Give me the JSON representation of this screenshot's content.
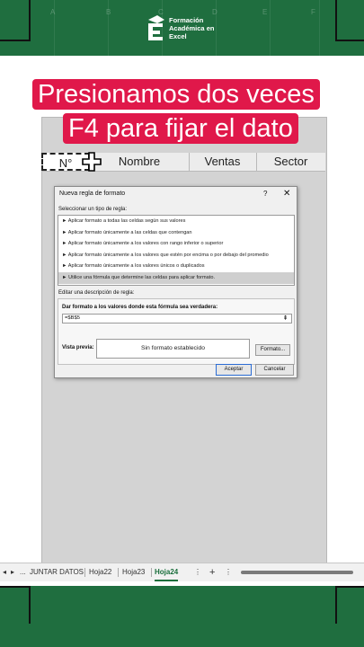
{
  "brand": {
    "logo_text": "Formación\nAcadémica en\nExcel",
    "green": "#1f6e3f",
    "pink": "#e0184a"
  },
  "background_column_letters": [
    "A",
    "B",
    "C",
    "D",
    "E",
    "F"
  ],
  "headline": {
    "line1": "Presionamos dos veces",
    "line2": "F4 para fijar el dato"
  },
  "sheet": {
    "headers": [
      "N°",
      "Nombre",
      "Ventas",
      "Sector"
    ],
    "selected_header": "N°"
  },
  "dialog": {
    "title": "Nueva regla de formato",
    "help": "?",
    "close": "✕",
    "select_label": "Seleccionar un tipo de regla:",
    "rule_types": [
      "► Aplicar formato a todas las celdas según sus valores",
      "► Aplicar formato únicamente a las celdas que contengan",
      "► Aplicar formato únicamente a los valores con rango inferior o superior",
      "► Aplicar formato únicamente a los valores que estén por encima o por debajo del promedio",
      "► Aplicar formato únicamente a los valores únicos o duplicados",
      "► Utilice una fórmula que determine las celdas para aplicar formato."
    ],
    "selected_rule_index": 5,
    "edit_label": "Editar una descripción de regla:",
    "formula_label": "Dar formato a los valores donde esta fórmula sea verdadera:",
    "formula_value": "=$B$5",
    "preview_label": "Vista previa:",
    "preview_text": "Sin formato establecido",
    "format_button": "Formato...",
    "accept_button": "Aceptar",
    "cancel_button": "Cancelar",
    "refedit_icon": "collapse-range-icon"
  },
  "tabs": {
    "nav_prev": "◂",
    "nav_next": "▸",
    "more": "...",
    "items": [
      "JUNTAR DATOS",
      "Hoja22",
      "Hoja23",
      "Hoja24"
    ],
    "active": "Hoja24",
    "add": "+",
    "options": "⋮"
  }
}
